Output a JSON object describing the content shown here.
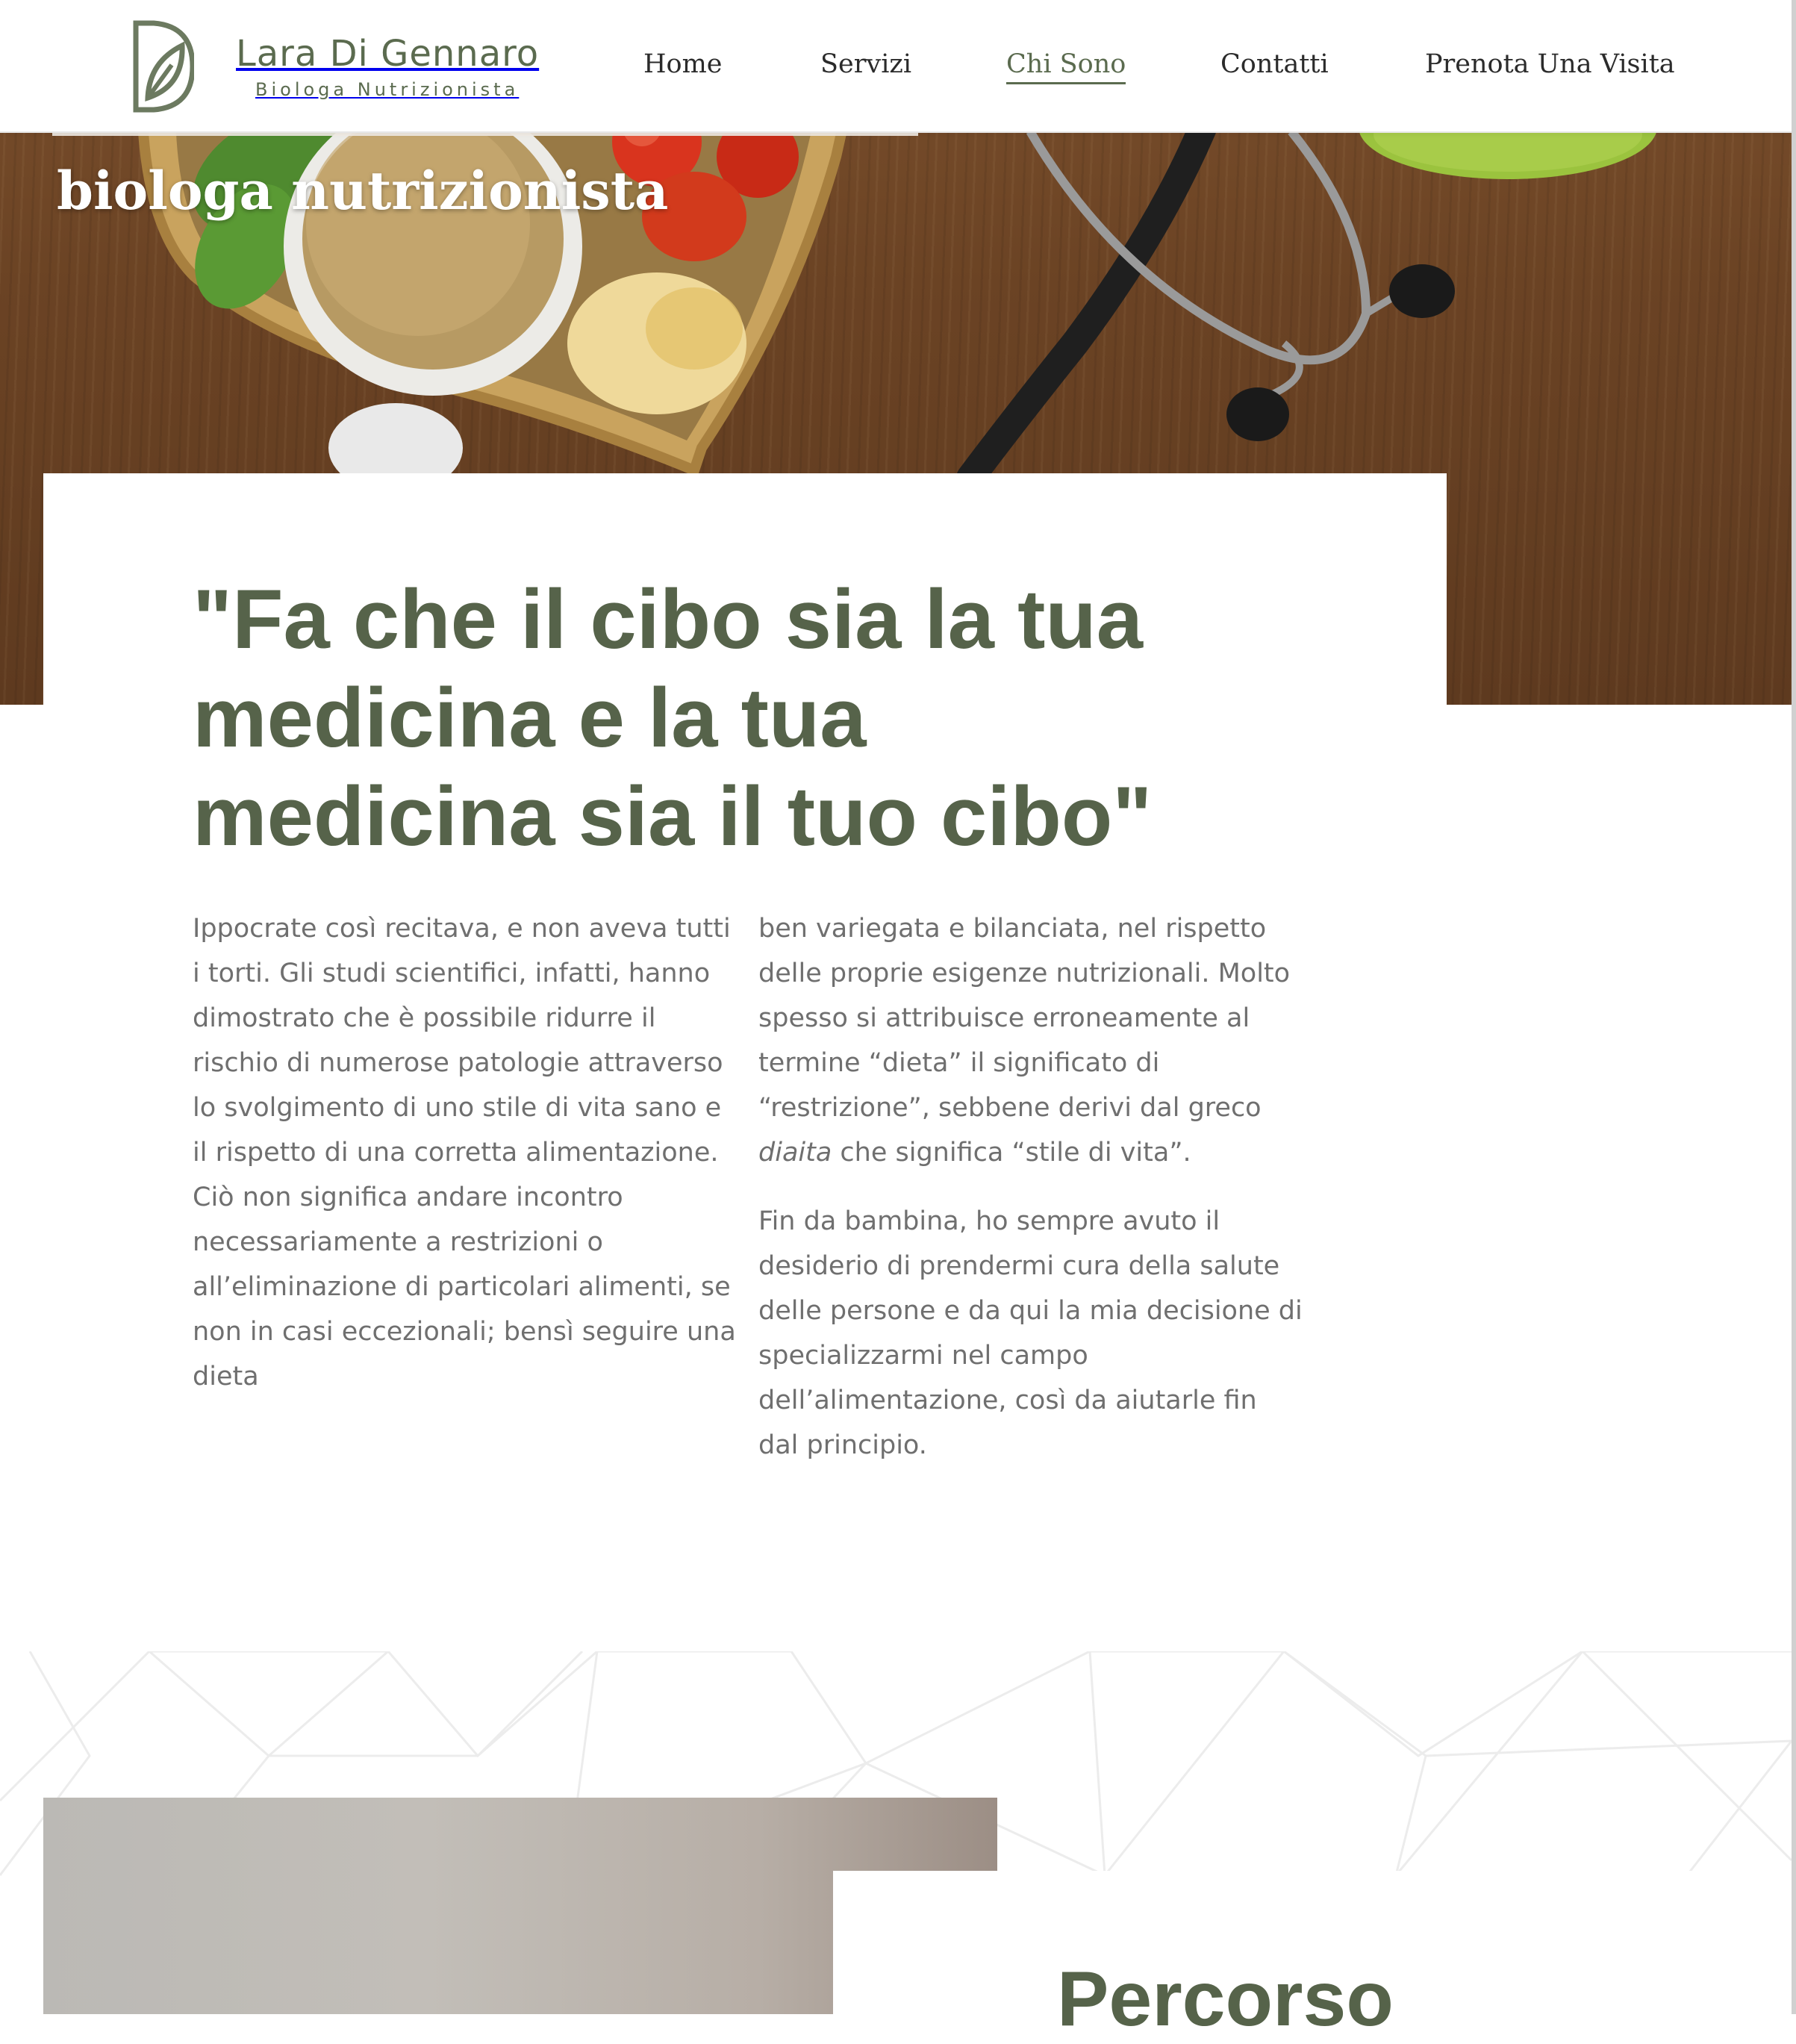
{
  "brand": {
    "name": "Lara Di Gennaro",
    "tagline": "Biologa Nutrizionista",
    "accent_color": "#5b6b4f"
  },
  "nav": {
    "items": [
      {
        "label": "Home",
        "active": false
      },
      {
        "label": "Servizi",
        "active": false
      },
      {
        "label": "Chi Sono",
        "active": true
      },
      {
        "label": "Contatti",
        "active": false
      },
      {
        "label": "Prenota Una Visita",
        "active": false
      }
    ]
  },
  "hero": {
    "subtitle": "biologa nutrizionista",
    "image_icons": [
      "wheat-bowl",
      "tomatoes",
      "heart-tray",
      "stethoscope",
      "green-apple",
      "dried-banana"
    ]
  },
  "intro": {
    "quote": "\"Fa che il cibo sia la tua medicina e la tua medicina sia il tuo cibo\"",
    "col1": "Ippocrate così recitava, e non aveva tutti i torti. Gli studi scientifici, infatti, hanno dimostrato che è possibile ridurre il rischio di numerose patologie attraverso lo svolgimento di uno stile di vita sano e il rispetto di una corretta alimentazione. Ciò non significa andare incontro necessariamente a restrizioni o all’eliminazione di particolari alimenti, se non in casi eccezionali; bensì seguire una dieta",
    "col2_p1_before": "ben variegata e bilanciata, nel rispetto delle proprie esigenze nutrizionali. Molto spesso si attribuisce erroneamente al termine “dieta” il significato di “restrizione”, sebbene derivi dal greco ",
    "col2_p1_em": "diaita",
    "col2_p1_after": " che significa “stile di vita”.",
    "col2_p2": "Fin da bambina, ho sempre avuto il desiderio di prendermi cura della salute delle persone e da qui la mia decisione di specializzarmi nel campo dell’alimentazione, così da aiutarle fin dal principio."
  },
  "about": {
    "heading": "Percorso"
  }
}
